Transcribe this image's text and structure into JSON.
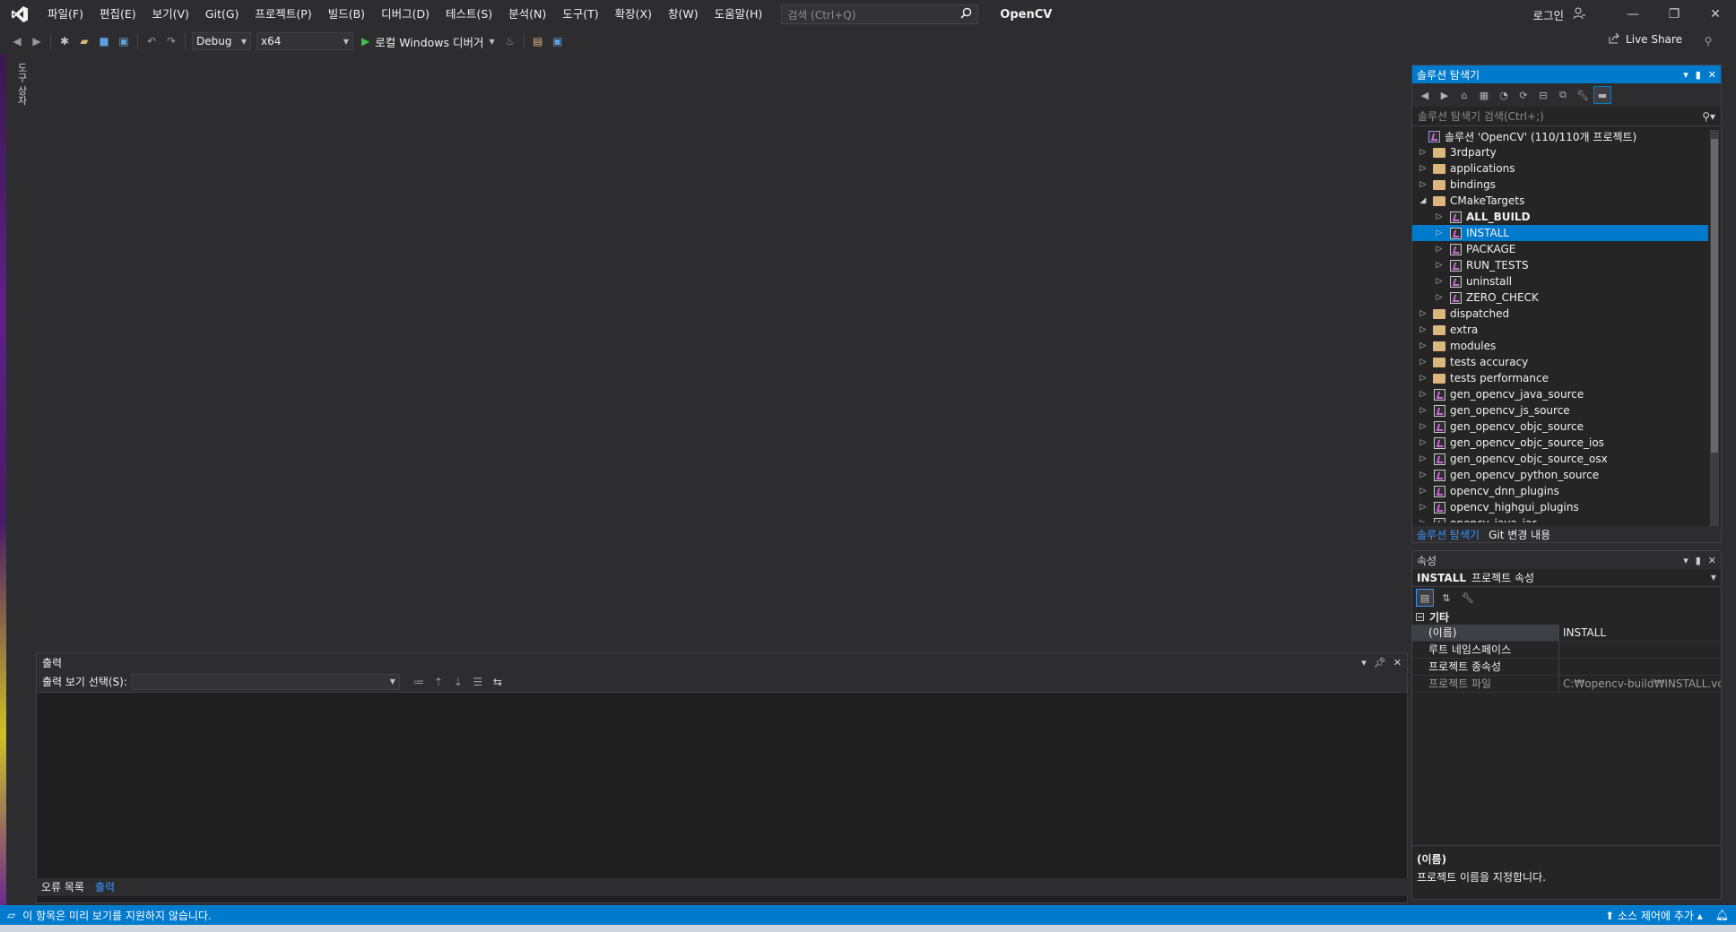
{
  "titlebar": {
    "menu": [
      "파일(F)",
      "편집(E)",
      "보기(V)",
      "Git(G)",
      "프로젝트(P)",
      "빌드(B)",
      "디버그(D)",
      "테스트(S)",
      "분석(N)",
      "도구(T)",
      "확장(X)",
      "창(W)",
      "도움말(H)"
    ],
    "search_placeholder": "검색 (Ctrl+Q)",
    "app_title": "OpenCV",
    "login": "로그인"
  },
  "toolbar": {
    "config": "Debug",
    "platform": "x64",
    "run_label": "로컬 Windows 디버거",
    "live_share": "Live Share"
  },
  "left_strip": {
    "toolbox": "도구 상자"
  },
  "solution_explorer": {
    "title": "솔루션 탐색기",
    "search_placeholder": "솔루션 탐색기 검색(Ctrl+;)",
    "root": "솔루션 'OpenCV' (110/110개 프로젝트)",
    "items": [
      {
        "label": "3rdparty",
        "type": "folder",
        "level": 1,
        "state": "collapsed"
      },
      {
        "label": "applications",
        "type": "folder",
        "level": 1,
        "state": "collapsed"
      },
      {
        "label": "bindings",
        "type": "folder",
        "level": 1,
        "state": "collapsed"
      },
      {
        "label": "CMakeTargets",
        "type": "folder",
        "level": 1,
        "state": "expanded"
      },
      {
        "label": "ALL_BUILD",
        "type": "project",
        "level": 2,
        "state": "collapsed",
        "bold": true
      },
      {
        "label": "INSTALL",
        "type": "project",
        "level": 2,
        "state": "collapsed",
        "selected": true
      },
      {
        "label": "PACKAGE",
        "type": "project",
        "level": 2,
        "state": "collapsed"
      },
      {
        "label": "RUN_TESTS",
        "type": "project",
        "level": 2,
        "state": "collapsed"
      },
      {
        "label": "uninstall",
        "type": "project",
        "level": 2,
        "state": "collapsed"
      },
      {
        "label": "ZERO_CHECK",
        "type": "project",
        "level": 2,
        "state": "collapsed"
      },
      {
        "label": "dispatched",
        "type": "folder",
        "level": 1,
        "state": "collapsed"
      },
      {
        "label": "extra",
        "type": "folder",
        "level": 1,
        "state": "collapsed"
      },
      {
        "label": "modules",
        "type": "folder",
        "level": 1,
        "state": "collapsed"
      },
      {
        "label": "tests accuracy",
        "type": "folder",
        "level": 1,
        "state": "collapsed"
      },
      {
        "label": "tests performance",
        "type": "folder",
        "level": 1,
        "state": "collapsed"
      },
      {
        "label": "gen_opencv_java_source",
        "type": "project",
        "level": 1,
        "state": "collapsed"
      },
      {
        "label": "gen_opencv_js_source",
        "type": "project",
        "level": 1,
        "state": "collapsed"
      },
      {
        "label": "gen_opencv_objc_source",
        "type": "project",
        "level": 1,
        "state": "collapsed"
      },
      {
        "label": "gen_opencv_objc_source_ios",
        "type": "project",
        "level": 1,
        "state": "collapsed"
      },
      {
        "label": "gen_opencv_objc_source_osx",
        "type": "project",
        "level": 1,
        "state": "collapsed"
      },
      {
        "label": "gen_opencv_python_source",
        "type": "project",
        "level": 1,
        "state": "collapsed"
      },
      {
        "label": "opencv_dnn_plugins",
        "type": "project",
        "level": 1,
        "state": "collapsed"
      },
      {
        "label": "opencv_highgui_plugins",
        "type": "project",
        "level": 1,
        "state": "collapsed"
      },
      {
        "label": "opencv_java_jar",
        "type": "project",
        "level": 1,
        "state": "collapsed"
      }
    ],
    "tabs": [
      "솔루션 탐색기",
      "Git 변경 내용"
    ]
  },
  "properties": {
    "title": "속성",
    "object_name": "INSTALL",
    "object_type": "프로젝트 속성",
    "category": "기타",
    "rows": [
      {
        "key": "(이름)",
        "value": "INSTALL"
      },
      {
        "key": "루트 네임스페이스",
        "value": ""
      },
      {
        "key": "프로젝트 종속성",
        "value": ""
      },
      {
        "key": "프로젝트 파일",
        "value": "C:₩opencv-build₩INSTALL.vcxp"
      }
    ],
    "desc_title": "(이름)",
    "desc_text": "프로젝트 이름을 지정합니다."
  },
  "output": {
    "title": "출력",
    "show_from_label": "출력 보기 선택(S):",
    "tabs": [
      "오류 목록",
      "출력"
    ]
  },
  "statusbar": {
    "message": "이 항목은 미리 보기를 지원하지 않습니다.",
    "source_control": "소스 제어에 추가"
  },
  "colors": {
    "accent": "#007acc",
    "background": "#2d2d30",
    "panel": "#252526",
    "run": "#3fc04a"
  }
}
